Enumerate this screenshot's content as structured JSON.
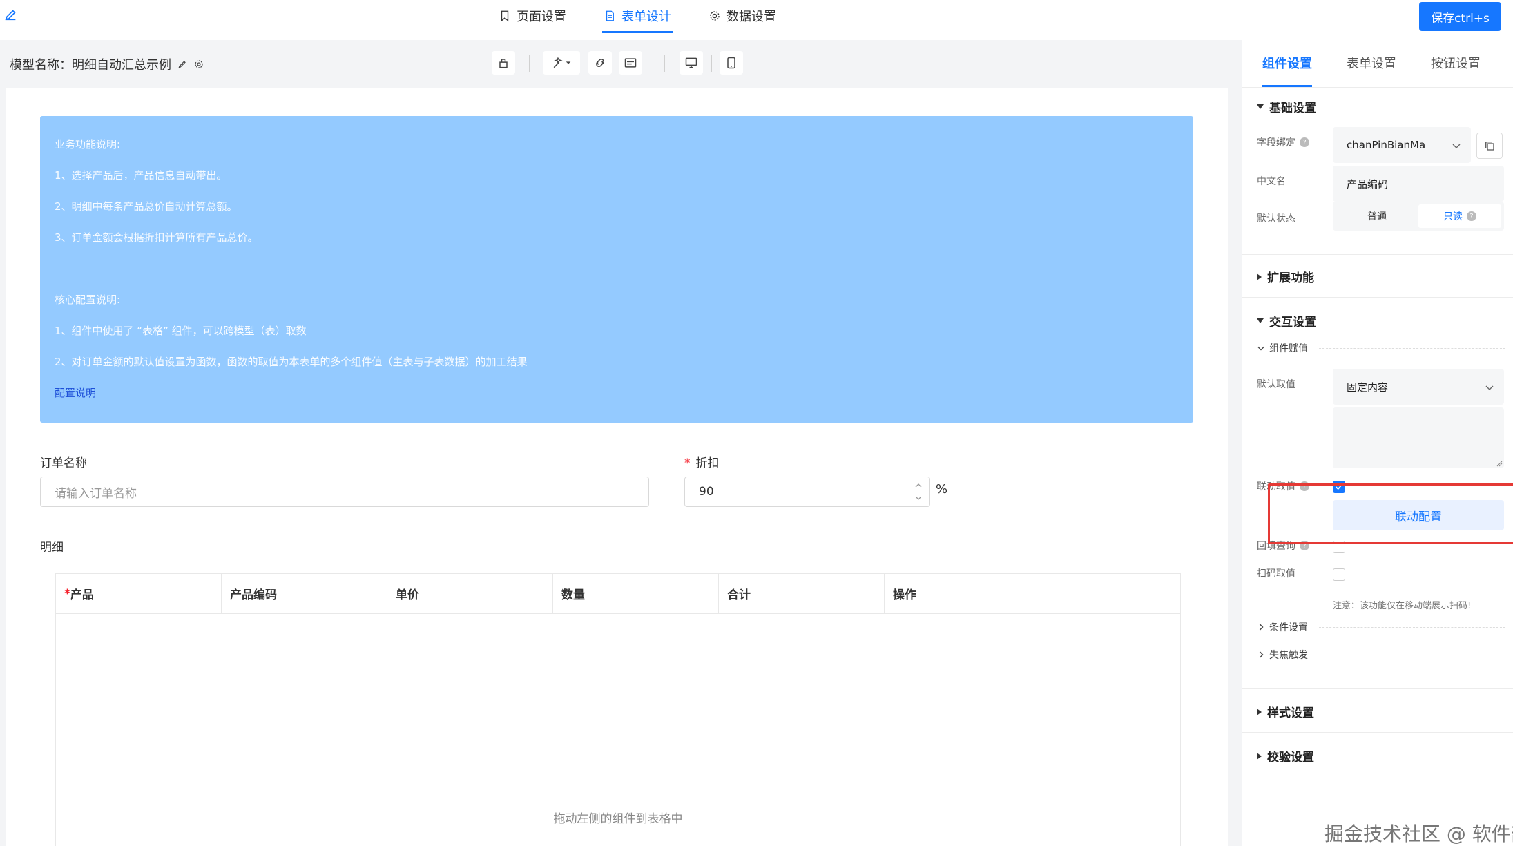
{
  "top": {
    "tabs": [
      {
        "label": "页面设置",
        "icon": "bookmark-icon"
      },
      {
        "label": "表单设计",
        "icon": "document-icon"
      },
      {
        "label": "数据设置",
        "icon": "gear-icon"
      }
    ],
    "active_tab": "表单设计",
    "save_label": "保存ctrl+s"
  },
  "model": {
    "name": "模型名称：明细自动汇总示例"
  },
  "info": {
    "lines": [
      "业务功能说明:",
      "1、选择产品后，产品信息自动带出。",
      "2、明细中每条产品总价自动计算总额。",
      "3、订单金额会根据折扣计算所有产品总价。",
      "核心配置说明:",
      "1、组件中使用了 “表格” 组件，可以跨模型（表）取数",
      "2、对订单金额的默认值设置为函数，函数的取值为本表单的多个组件值（主表与子表数据）的加工结果"
    ],
    "link": "配置说明"
  },
  "form": {
    "order_name_label": "订单名称",
    "order_name_placeholder": "请输入订单名称",
    "discount_label": "折扣",
    "discount_value": "90",
    "discount_unit": "%",
    "detail_label": "明细"
  },
  "table": {
    "required_mark": "*",
    "columns": [
      "产品",
      "产品编码",
      "单价",
      "数量",
      "合计",
      "操作"
    ],
    "empty_hint": "拖动左侧的组件到表格中"
  },
  "panel": {
    "tabs": [
      "组件设置",
      "表单设置",
      "按钮设置"
    ],
    "basic_title": "基础设置",
    "field_bind_label": "字段绑定",
    "field_bind_value": "chanPinBianMa",
    "cn_name_label": "中文名",
    "cn_name_value": "产品编码",
    "default_state_label": "默认状态",
    "state_options": [
      "普通",
      "只读"
    ],
    "state_selected": "只读",
    "ext_title": "扩展功能",
    "interact_title": "交互设置",
    "assign_title": "组件赋值",
    "default_value_label": "默认取值",
    "default_value_value": "固定内容",
    "linkage_label": "联动取值",
    "linkage_checked": true,
    "linkage_btn": "联动配置",
    "backfill_label": "回填查询",
    "scan_label": "扫码取值",
    "scan_note": "注意：该功能仅在移动端展示扫码!",
    "condition_title": "条件设置",
    "blur_title": "失焦触发",
    "style_title": "样式设置",
    "validate_title": "校验设置"
  },
  "watermark": "掘金技术社区 @ 软件部长"
}
